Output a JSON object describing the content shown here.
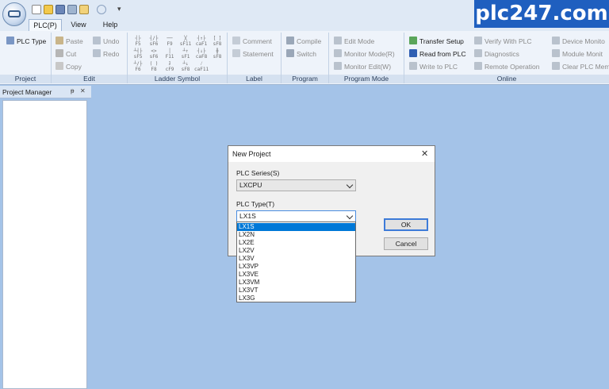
{
  "watermark": "plc247.com",
  "menu_tabs": [
    {
      "label": "PLC(P)",
      "active": true
    },
    {
      "label": "View",
      "active": false
    },
    {
      "label": "Help",
      "active": false
    }
  ],
  "ribbon": {
    "project": {
      "label": "Project",
      "plc_type": "PLC Type"
    },
    "edit": {
      "label": "Edit",
      "paste": "Paste",
      "cut": "Cut",
      "copy": "Copy",
      "undo": "Undo",
      "redo": "Redo"
    },
    "ladder_symbol": {
      "label": "Ladder Symbol",
      "keys": [
        "F5",
        "sF6",
        "F9",
        "sF11",
        "caF1",
        "sF8",
        "sF5",
        "sF6",
        "F11",
        "sF1",
        "caF8",
        "sF8",
        "F6",
        "F8",
        "cF9",
        "sF8",
        "caF11"
      ]
    },
    "label_group": {
      "label": "Label",
      "comment": "Comment",
      "statement": "Statement"
    },
    "program": {
      "label": "Program",
      "compile": "Compile",
      "switch": "Switch"
    },
    "program_mode": {
      "label": "Program Mode",
      "edit_mode": "Edit Mode",
      "monitor_mode": "Monitor Mode(R)",
      "monitor_edit": "Monitor Edit(W)"
    },
    "online": {
      "label": "Online",
      "transfer_setup": "Transfer Setup",
      "read_from_plc": "Read from PLC",
      "write_to_plc": "Write to PLC",
      "verify_with_plc": "Verify With PLC",
      "diagnostics": "Diagnostics",
      "remote_operation": "Remote Operation",
      "device_monitor": "Device Monito",
      "module_monitor": "Module Monit",
      "clear_plc_memory": "Clear PLC Mem"
    }
  },
  "project_manager": {
    "title": "Project Manager",
    "pin_glyph": "ᵽ",
    "close_glyph": "✕"
  },
  "dialog": {
    "title": "New Project",
    "close_glyph": "✕",
    "plc_series_label": "PLC Series(S)",
    "plc_series_value": "LXCPU",
    "plc_type_label": "PLC Type(T)",
    "plc_type_value": "LX1S",
    "ok_label": "OK",
    "cancel_label": "Cancel",
    "plc_type_options": [
      "LX1S",
      "LX2N",
      "LX2E",
      "LX2V",
      "LX3V",
      "LX3VP",
      "LX3VE",
      "LX3VM",
      "LX3VT",
      "LX3G"
    ],
    "selected_option": "LX1S"
  }
}
